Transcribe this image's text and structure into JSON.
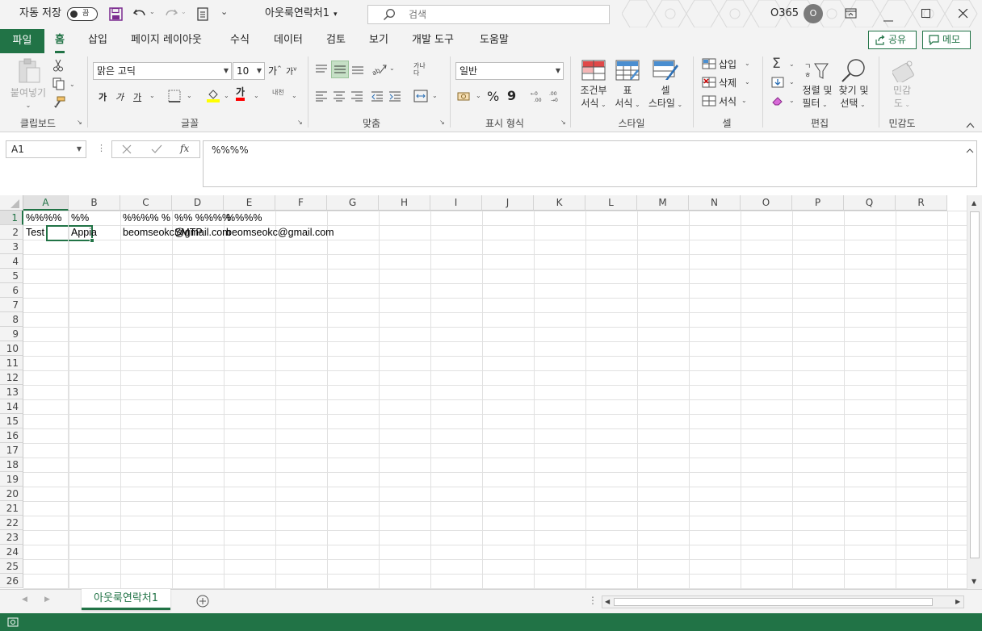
{
  "title_bar": {
    "autosave_label": "자동 저장",
    "autosave_state": "끔",
    "document_title": "아웃룩연락처1",
    "search_placeholder": "검색",
    "account_name": "O365",
    "avatar_initial": "O"
  },
  "ribbon_tabs": {
    "file": "파일",
    "items": [
      "홈",
      "삽입",
      "페이지 레이아웃",
      "수식",
      "데이터",
      "검토",
      "보기",
      "개발 도구",
      "도움말"
    ],
    "active": "홈",
    "share_label": "공유",
    "comment_label": "메모"
  },
  "ribbon": {
    "clipboard": {
      "paste_label": "붙여넣기",
      "group_label": "클립보드"
    },
    "font": {
      "font_name": "맑은 고딕",
      "font_size": "10",
      "grow_label": "가",
      "shrink_label": "가",
      "bold": "가",
      "italic": "가",
      "underline": "가",
      "font_color_glyph": "가",
      "phonetic": "내천",
      "group_label": "글꼴"
    },
    "alignment": {
      "wrap_glyph": "가나 다",
      "group_label": "맞춤"
    },
    "number": {
      "format": "일반",
      "percent": "%",
      "comma": "9",
      "group_label": "표시 형식"
    },
    "styles": {
      "conditional": [
        "조건부",
        "서식"
      ],
      "table": [
        "표",
        "서식"
      ],
      "cell": [
        "셀",
        "스타일"
      ],
      "group_label": "스타일"
    },
    "cells": {
      "insert": "삽입",
      "delete": "삭제",
      "format": "서식",
      "group_label": "셀"
    },
    "editing": {
      "sort": [
        "정렬 및",
        "필터"
      ],
      "find": [
        "찾기 및",
        "선택"
      ],
      "group_label": "편집"
    },
    "sensitivity": {
      "label": [
        "민감",
        "도"
      ],
      "group_label": "민감도"
    }
  },
  "formula_bar": {
    "name_box": "A1",
    "fx": "fx",
    "content": "%%%%"
  },
  "sheet": {
    "columns": [
      "A",
      "B",
      "C",
      "D",
      "E",
      "F",
      "G",
      "H",
      "I",
      "J",
      "K",
      "L",
      "M",
      "N",
      "O",
      "P",
      "Q",
      "R"
    ],
    "rows": [
      "1",
      "2",
      "3",
      "4",
      "5",
      "6",
      "7",
      "8",
      "9",
      "10",
      "11",
      "12",
      "13",
      "14",
      "15",
      "16",
      "17",
      "18",
      "19",
      "20",
      "21",
      "22",
      "23",
      "24",
      "25",
      "26"
    ],
    "selected_cell": "A1",
    "cells": {
      "A1": "%%%%",
      "B1": "%%",
      "C1": "%%%% %",
      "D1": "%%  %%%%",
      "E1": "%%%%",
      "A2": "Test",
      "B2": "Appia",
      "C2": "beomseokc@gmail.com",
      "D2": "SMTP",
      "E2": "beomseokc@gmail.com"
    }
  },
  "sheet_tabs": {
    "active_sheet": "아웃룩연락처1"
  },
  "colors": {
    "accent": "#217346",
    "chrome": "#f3f3f3"
  }
}
